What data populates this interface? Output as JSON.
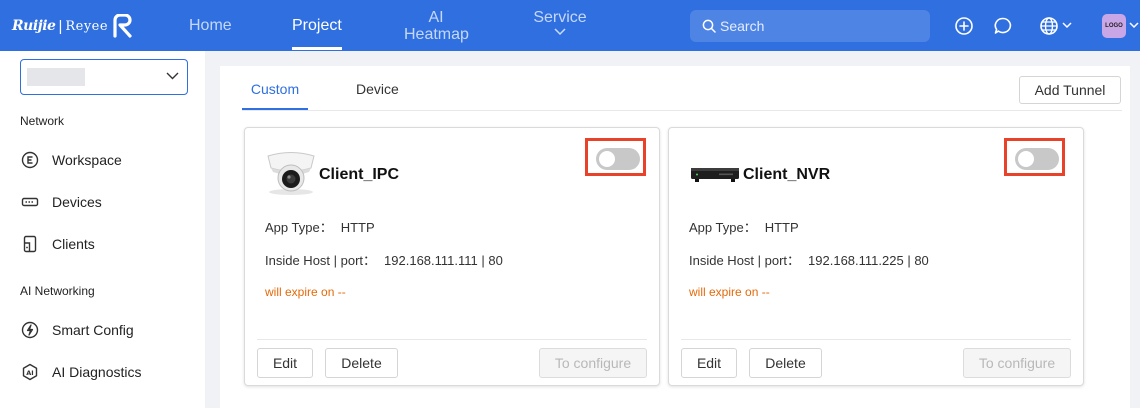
{
  "header": {
    "logo_brand": "Ruijie",
    "logo_separator": "|",
    "logo_product": "Reyee",
    "nav": {
      "home": "Home",
      "project": "Project",
      "ai_heatmap_line1": "AI",
      "ai_heatmap_line2": "Heatmap",
      "service": "Service"
    },
    "search_placeholder": "Search",
    "avatar_text": "LOGO"
  },
  "sidebar": {
    "selector_value": "",
    "section_network": "Network",
    "section_ai_networking": "AI Networking",
    "items": {
      "workspace": "Workspace",
      "devices": "Devices",
      "clients": "Clients",
      "smart_config": "Smart Config",
      "ai_diagnostics": "AI Diagnostics"
    }
  },
  "main": {
    "tabs": {
      "custom": "Custom",
      "device": "Device"
    },
    "add_tunnel_label": "Add Tunnel",
    "cards": [
      {
        "title": "Client_IPC",
        "enabled": false,
        "app_type_label": "App Type：",
        "app_type": "HTTP",
        "host_label": "Inside Host | port：",
        "host_value": "192.168.111.111 | 80",
        "expire": "will expire on --",
        "edit_label": "Edit",
        "delete_label": "Delete",
        "configure_label": "To configure"
      },
      {
        "title": "Client_NVR",
        "enabled": false,
        "app_type_label": "App Type：",
        "app_type": "HTTP",
        "host_label": "Inside Host | port：",
        "host_value": "192.168.111.225 | 80",
        "expire": "will expire on --",
        "edit_label": "Edit",
        "delete_label": "Delete",
        "configure_label": "To configure"
      }
    ]
  },
  "colors": {
    "brand_blue": "#2f6fe0",
    "highlight_red": "#e8432a",
    "expire_orange": "#e36a0a"
  }
}
